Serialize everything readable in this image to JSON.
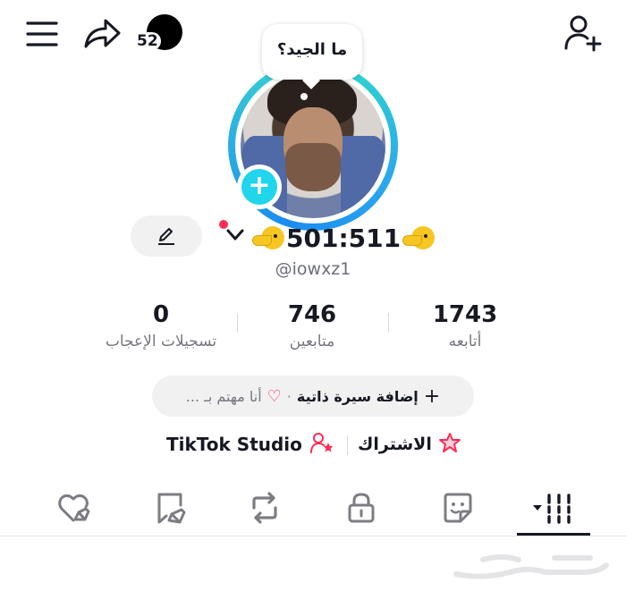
{
  "topbar": {
    "menu_icon": "hamburger-menu-icon",
    "share_icon": "share-arrow-icon",
    "notification_count": "52",
    "add_friend_icon": "add-user-icon"
  },
  "avatar": {
    "bubble_text": "ما الجيد؟",
    "add_icon": "plus-icon",
    "ring_colors": [
      "#2fe0c8",
      "#2aa5ee"
    ]
  },
  "profile": {
    "display_name": "501:511",
    "username": "@iowxz1",
    "edit_icon": "pencil-icon",
    "dropdown_icon": "chevron-down-icon"
  },
  "stats": [
    {
      "value": "1743",
      "label": "أتابعه"
    },
    {
      "value": "746",
      "label": "متابعين"
    },
    {
      "value": "0",
      "label": "تسجيلات الإعجاب"
    }
  ],
  "bio": {
    "add_label": "إضافة سيرة ذاتية",
    "separator": "·",
    "interests_label": "أنا مهتم بـ ..."
  },
  "links": {
    "subscription_label": "الاشتراك",
    "studio_label": "TikTok Studio"
  },
  "tabs": [
    {
      "icon": "grid-dropdown-icon",
      "active": true
    },
    {
      "icon": "sticker-icon",
      "active": false
    },
    {
      "icon": "lock-icon",
      "active": false
    },
    {
      "icon": "repost-icon",
      "active": false
    },
    {
      "icon": "bookmark-icon",
      "active": false
    },
    {
      "icon": "liked-heart-icon",
      "active": false
    }
  ],
  "colors": {
    "accent": "#fe2c55",
    "avatar_plus": "#20d5ec",
    "text": "#161823"
  }
}
